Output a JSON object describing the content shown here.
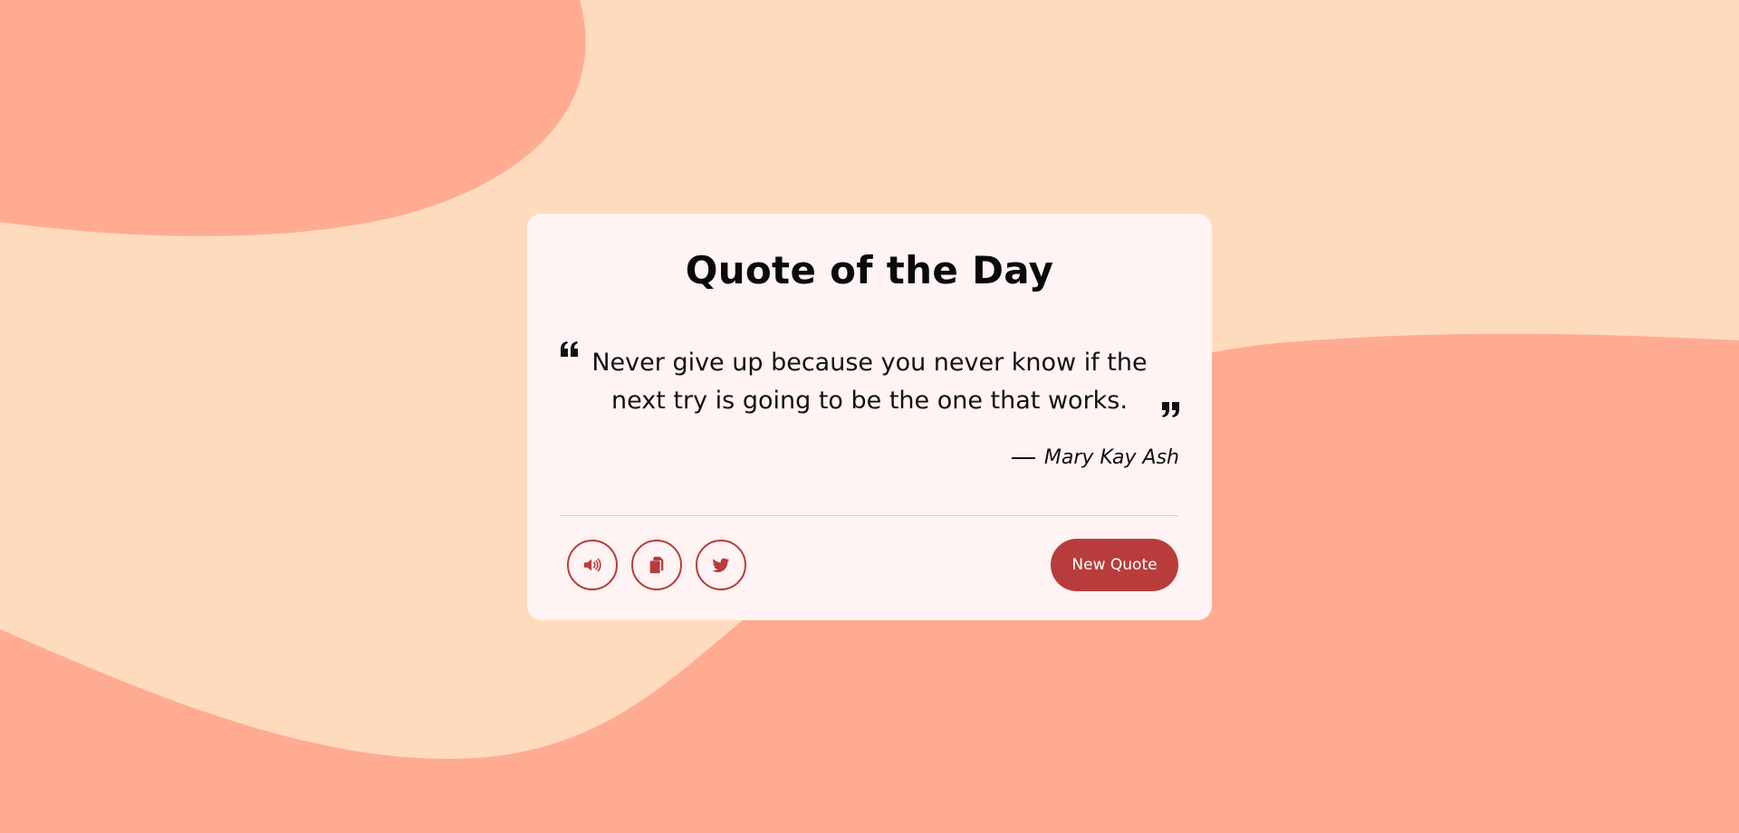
{
  "colors": {
    "background": "#FFDBBE",
    "blob": "#FFAB92",
    "card": "#FFF3F3",
    "accent": "#B83C3C",
    "text": "#111111"
  },
  "card": {
    "title": "Quote of the Day",
    "quote": "Never give up because you never know if the next try is going to be the one that works.",
    "author": "Mary Kay Ash"
  },
  "actions": {
    "speak_icon": "volume-icon",
    "copy_icon": "copy-icon",
    "tweet_icon": "twitter-icon",
    "new_quote_label": "New Quote"
  }
}
